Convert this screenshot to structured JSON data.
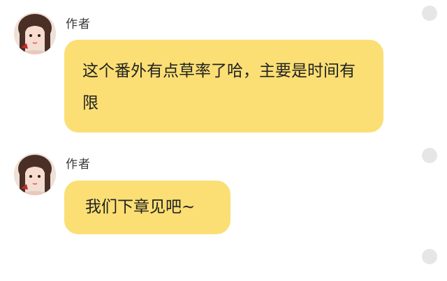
{
  "messages": [
    {
      "sender": "作者",
      "text": "这个番外有点草率了哈，主要是时间有限"
    },
    {
      "sender": "作者",
      "text": "我们下章见吧~"
    }
  ],
  "colors": {
    "bubble": "#fbdf74",
    "select_dot": "#e6e6e6"
  }
}
